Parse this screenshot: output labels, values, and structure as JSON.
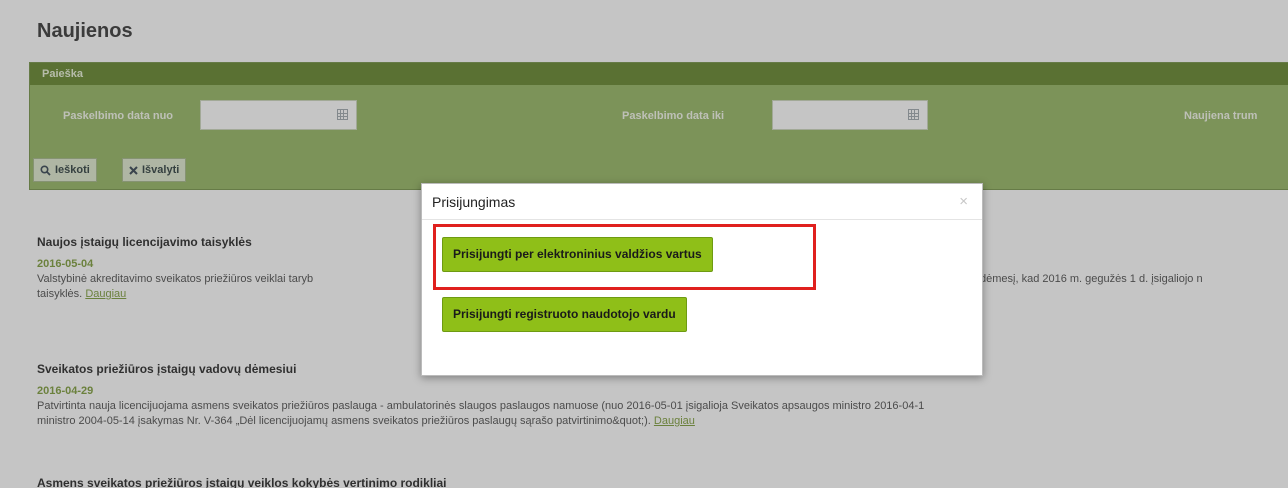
{
  "page": {
    "title": "Naujienos"
  },
  "search": {
    "header": "Paieška",
    "date_from_label": "Paskelbimo data nuo",
    "date_to_label": "Paskelbimo data iki",
    "summary_label": "Naujiena trum",
    "date_from_value": "",
    "date_to_value": "",
    "search_button": "Ieškoti",
    "clear_button": "Išvalyti",
    "icons": {
      "calendar": "calendar-icon",
      "search": "search-icon",
      "clear": "close-icon"
    }
  },
  "news": [
    {
      "title": "Naujos įstaigų licencijavimo taisyklės",
      "date": "2016-05-04",
      "body_start": "Valstybinė akreditavimo sveikatos priežiūros veiklai taryb",
      "body_end": "dėmesį, kad 2016 m. gegužės 1 d. įsigaliojo n",
      "body_line2": "taisyklės.",
      "link": "Daugiau"
    },
    {
      "title": "Sveikatos priežiūros įstaigų vadovų dėmesiui",
      "date": "2016-04-29",
      "body_line1": "Patvirtinta nauja licencijuojama asmens sveikatos priežiūros paslauga - ambulatorinės slaugos paslaugos namuose (nuo 2016-05-01 įsigalioja Sveikatos apsaugos ministro 2016-04-1",
      "body_line2": "ministro 2004-05-14 įsakymas Nr. V-364 „Dėl licencijuojamų asmens sveikatos priežiūros paslaugų sąrašo patvirtinimo&quot;).",
      "link": "Daugiau"
    },
    {
      "title": "Asmens sveikatos priežiūros įstaigų veiklos kokybės vertinimo rodikliai"
    }
  ],
  "modal": {
    "title": "Prisijungimas",
    "close": "×",
    "btn_evartai": "Prisijungti per elektroninius valdžios vartus",
    "btn_registered": "Prisijungti registruoto naudotojo vardu",
    "highlight_color": "#e0201e",
    "button_color": "#8fbf18"
  }
}
